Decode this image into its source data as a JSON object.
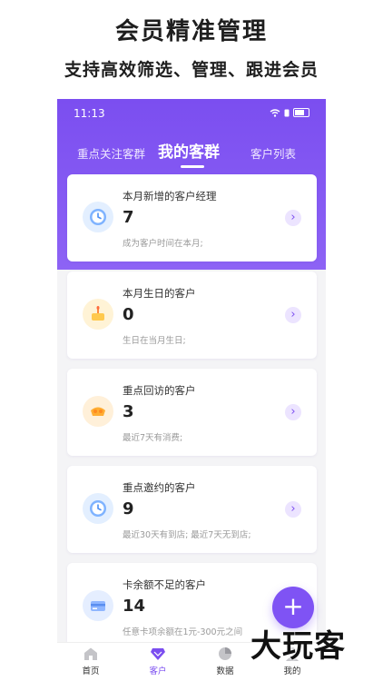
{
  "promo": {
    "title": "会员精准管理",
    "subtitle": "支持高效筛选、管理、跟进会员"
  },
  "status_bar": {
    "time": "11:13"
  },
  "tabs": [
    {
      "label": "重点关注客群"
    },
    {
      "label": "我的客群"
    },
    {
      "label": "客户列表"
    }
  ],
  "cards": [
    {
      "title": "本月新增的客户经理",
      "value": "7",
      "desc": "成为客户时间在本月;",
      "icon": "clock-icon",
      "accent": "#8fc2ff"
    },
    {
      "title": "本月生日的客户",
      "value": "0",
      "desc": "生日在当月生日;",
      "icon": "birthday-cake-icon",
      "accent": "#ffc94d"
    },
    {
      "title": "重点回访的客户",
      "value": "3",
      "desc": "最近7天有消费;",
      "icon": "gift-box-icon",
      "accent": "#ffad33"
    },
    {
      "title": "重点邀约的客户",
      "value": "9",
      "desc": "最近30天有到店; 最近7天无到店;",
      "icon": "clock-icon",
      "accent": "#8fc2ff"
    },
    {
      "title": "卡余额不足的客户",
      "value": "14",
      "desc": "任意卡项余额在1元-300元之间",
      "icon": "card-icon",
      "accent": "#8fb6ff"
    }
  ],
  "fab": {
    "label": "+"
  },
  "tabbar": [
    {
      "label": "首页"
    },
    {
      "label": "客户"
    },
    {
      "label": "数据"
    },
    {
      "label": "我的"
    }
  ],
  "watermark": "大玩客",
  "colors": {
    "primary": "#7b4ef0",
    "background": "#f4f4f6"
  }
}
